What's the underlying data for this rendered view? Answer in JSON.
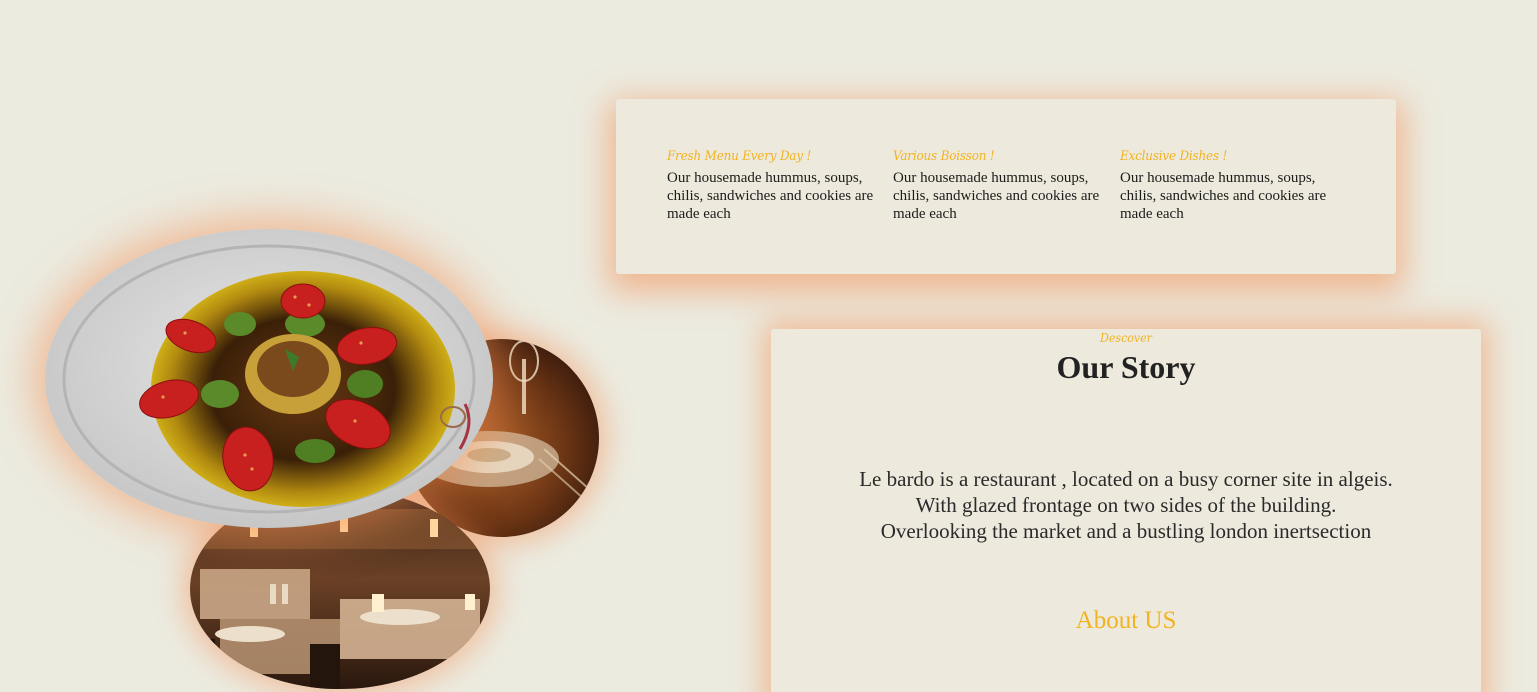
{
  "features": [
    {
      "title": "Fresh Menu Every Day !",
      "text": "Our housemade hummus, soups, chilis, sandwiches and cookies are made each"
    },
    {
      "title": "Various Boisson !",
      "text": "Our housemade hummus, soups, chilis, sandwiches and cookies are made each"
    },
    {
      "title": "Exclusive Dishes !",
      "text": "Our housemade hummus, soups, chilis, sandwiches and cookies are made each"
    }
  ],
  "story": {
    "eyebrow": "Descover",
    "title": "Our Story",
    "lines": [
      "Le bardo is a restaurant , located on a busy corner site in algeis.",
      "With glazed frontage on two sides of the building.",
      "Overlooking the market and a bustling london inertsection"
    ],
    "link_label": "About US"
  },
  "images": {
    "dish": "dessert-plate-image",
    "dining_top": "dining-table-image",
    "dining_bottom": "restaurant-interior-image"
  },
  "colors": {
    "background": "#ecebe0",
    "card": "#edeadd",
    "accent": "#f1b320",
    "glow": "#f38c50"
  }
}
